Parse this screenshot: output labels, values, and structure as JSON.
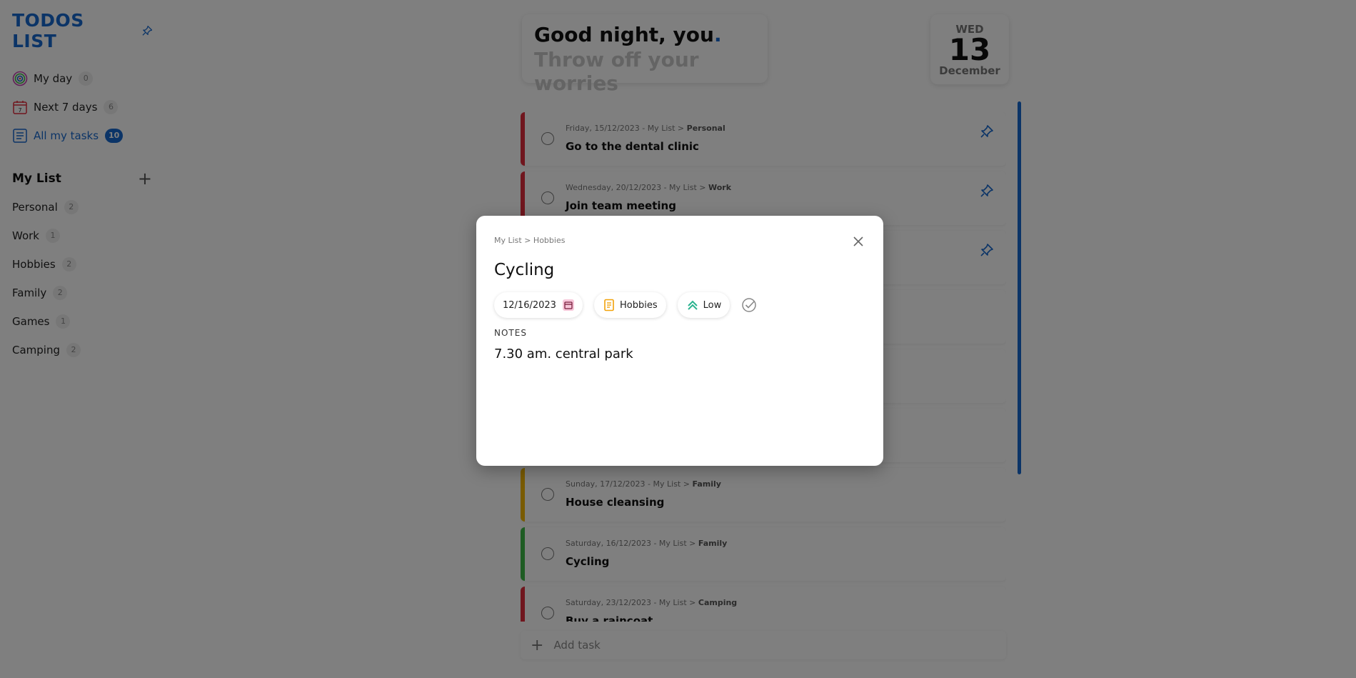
{
  "app": {
    "title": "TODOS LIST"
  },
  "nav": [
    {
      "label": "My day",
      "count": "0",
      "icon": "target-icon"
    },
    {
      "label": "Next 7 days",
      "count": "6",
      "icon": "calendar-icon"
    },
    {
      "label": "All my tasks",
      "count": "10",
      "icon": "list-icon",
      "active": true
    }
  ],
  "my_list": {
    "heading": "My List",
    "add_icon": "plus-icon",
    "items": [
      {
        "label": "Personal",
        "count": "2"
      },
      {
        "label": "Work",
        "count": "1"
      },
      {
        "label": "Hobbies",
        "count": "2"
      },
      {
        "label": "Family",
        "count": "2"
      },
      {
        "label": "Games",
        "count": "1"
      },
      {
        "label": "Camping",
        "count": "2"
      }
    ]
  },
  "greeting": {
    "line1": "Good night, you",
    "line1_dot": ".",
    "line2": "Throw off your worries"
  },
  "date": {
    "dow": "WED",
    "day": "13",
    "month": "December"
  },
  "tasks": [
    {
      "meta": "Friday, 15/12/2023 - My List > ",
      "list": "Personal",
      "title": "Go to the dental clinic",
      "color": "#e02c3c",
      "pinned": true
    },
    {
      "meta": "Wednesday, 20/12/2023 - My List > ",
      "list": "Work",
      "title": "Join team meeting",
      "color": "#e02c3c",
      "pinned": true
    },
    {
      "meta": "",
      "list": "",
      "title": "",
      "color": "#dddddd",
      "pinned": true
    },
    {
      "meta": "",
      "list": "",
      "title": "",
      "color": "#dddddd",
      "pinned": false
    },
    {
      "meta": "",
      "list": "",
      "title": "",
      "color": "#dddddd",
      "pinned": false
    },
    {
      "meta": "",
      "list": "",
      "title": "",
      "color": "#dddddd",
      "pinned": false
    },
    {
      "meta": "Sunday, 17/12/2023 - My List > ",
      "list": "Family",
      "title": "House cleansing",
      "color": "#f2b705",
      "pinned": false
    },
    {
      "meta": "Saturday, 16/12/2023 - My List > ",
      "list": "Family",
      "title": "Cycling",
      "color": "#3cb846",
      "pinned": false
    },
    {
      "meta": "Saturday, 23/12/2023 - My List > ",
      "list": "Camping",
      "title": "Buy a raincoat",
      "color": "#e02c3c",
      "pinned": false
    }
  ],
  "add_task": {
    "placeholder": "Add task"
  },
  "modal": {
    "breadcrumb": "My List > Hobbies",
    "title": "Cycling",
    "date_value": "12/16/2023",
    "list_chip": "Hobbies",
    "priority_chip": "Low",
    "notes_label": "NOTES",
    "notes": "7.30 am. central park"
  },
  "colors": {
    "accent": "#1769cf",
    "red": "#e02c3c",
    "yellow": "#f2b705",
    "green": "#3cb846"
  }
}
